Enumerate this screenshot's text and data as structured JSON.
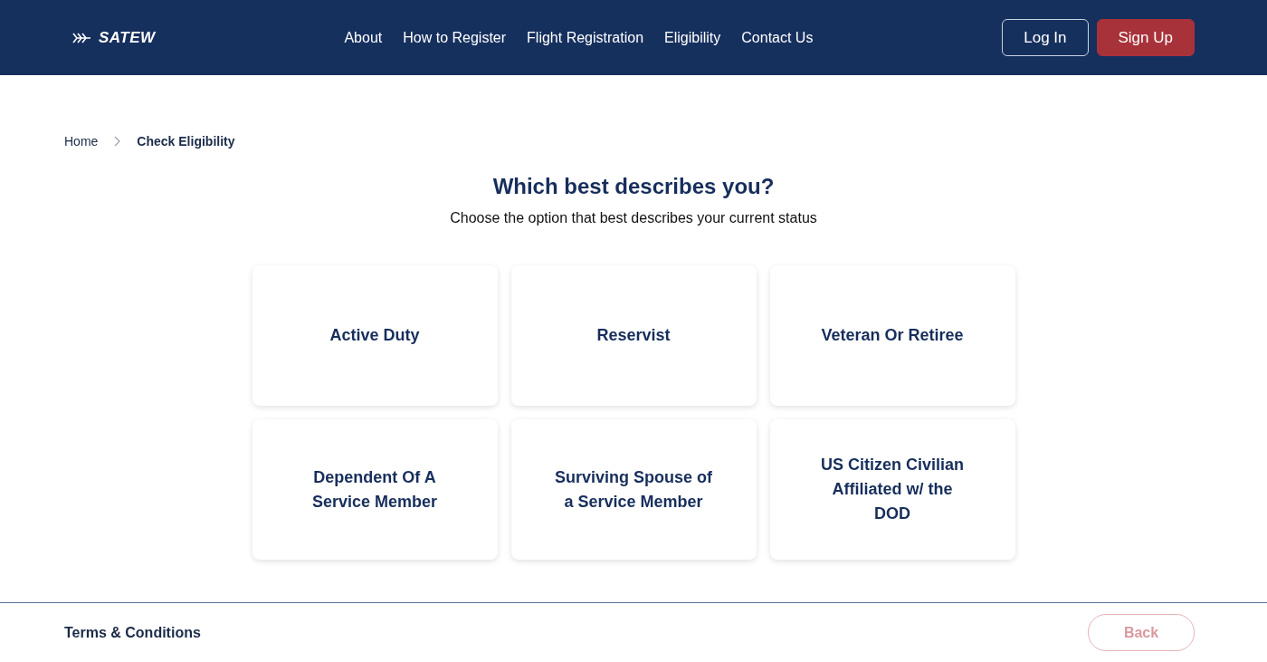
{
  "header": {
    "logo": "SATEW",
    "nav": [
      "About",
      "How to Register",
      "Flight Registration",
      "Eligibility",
      "Contact Us"
    ],
    "buttons": [
      {
        "label": "Log In",
        "kind": "outline"
      },
      {
        "label": "Sign Up",
        "kind": "filled"
      }
    ]
  },
  "breadcrumb": [
    "Home",
    "Check Eligibility"
  ],
  "heading": "Which best describes you?",
  "subheading": "Choose the option that best describes your current status",
  "options": [
    "Active Duty",
    "Reservist",
    "Veteran Or Retiree",
    "Dependent Of A Service Member",
    "Surviving Spouse of a Service Member",
    "US Citizen Civilian Affiliated w/ the DOD"
  ],
  "footer": {
    "link": "Terms & Conditions",
    "back_button": {
      "label": "Back",
      "disabled": true
    }
  }
}
